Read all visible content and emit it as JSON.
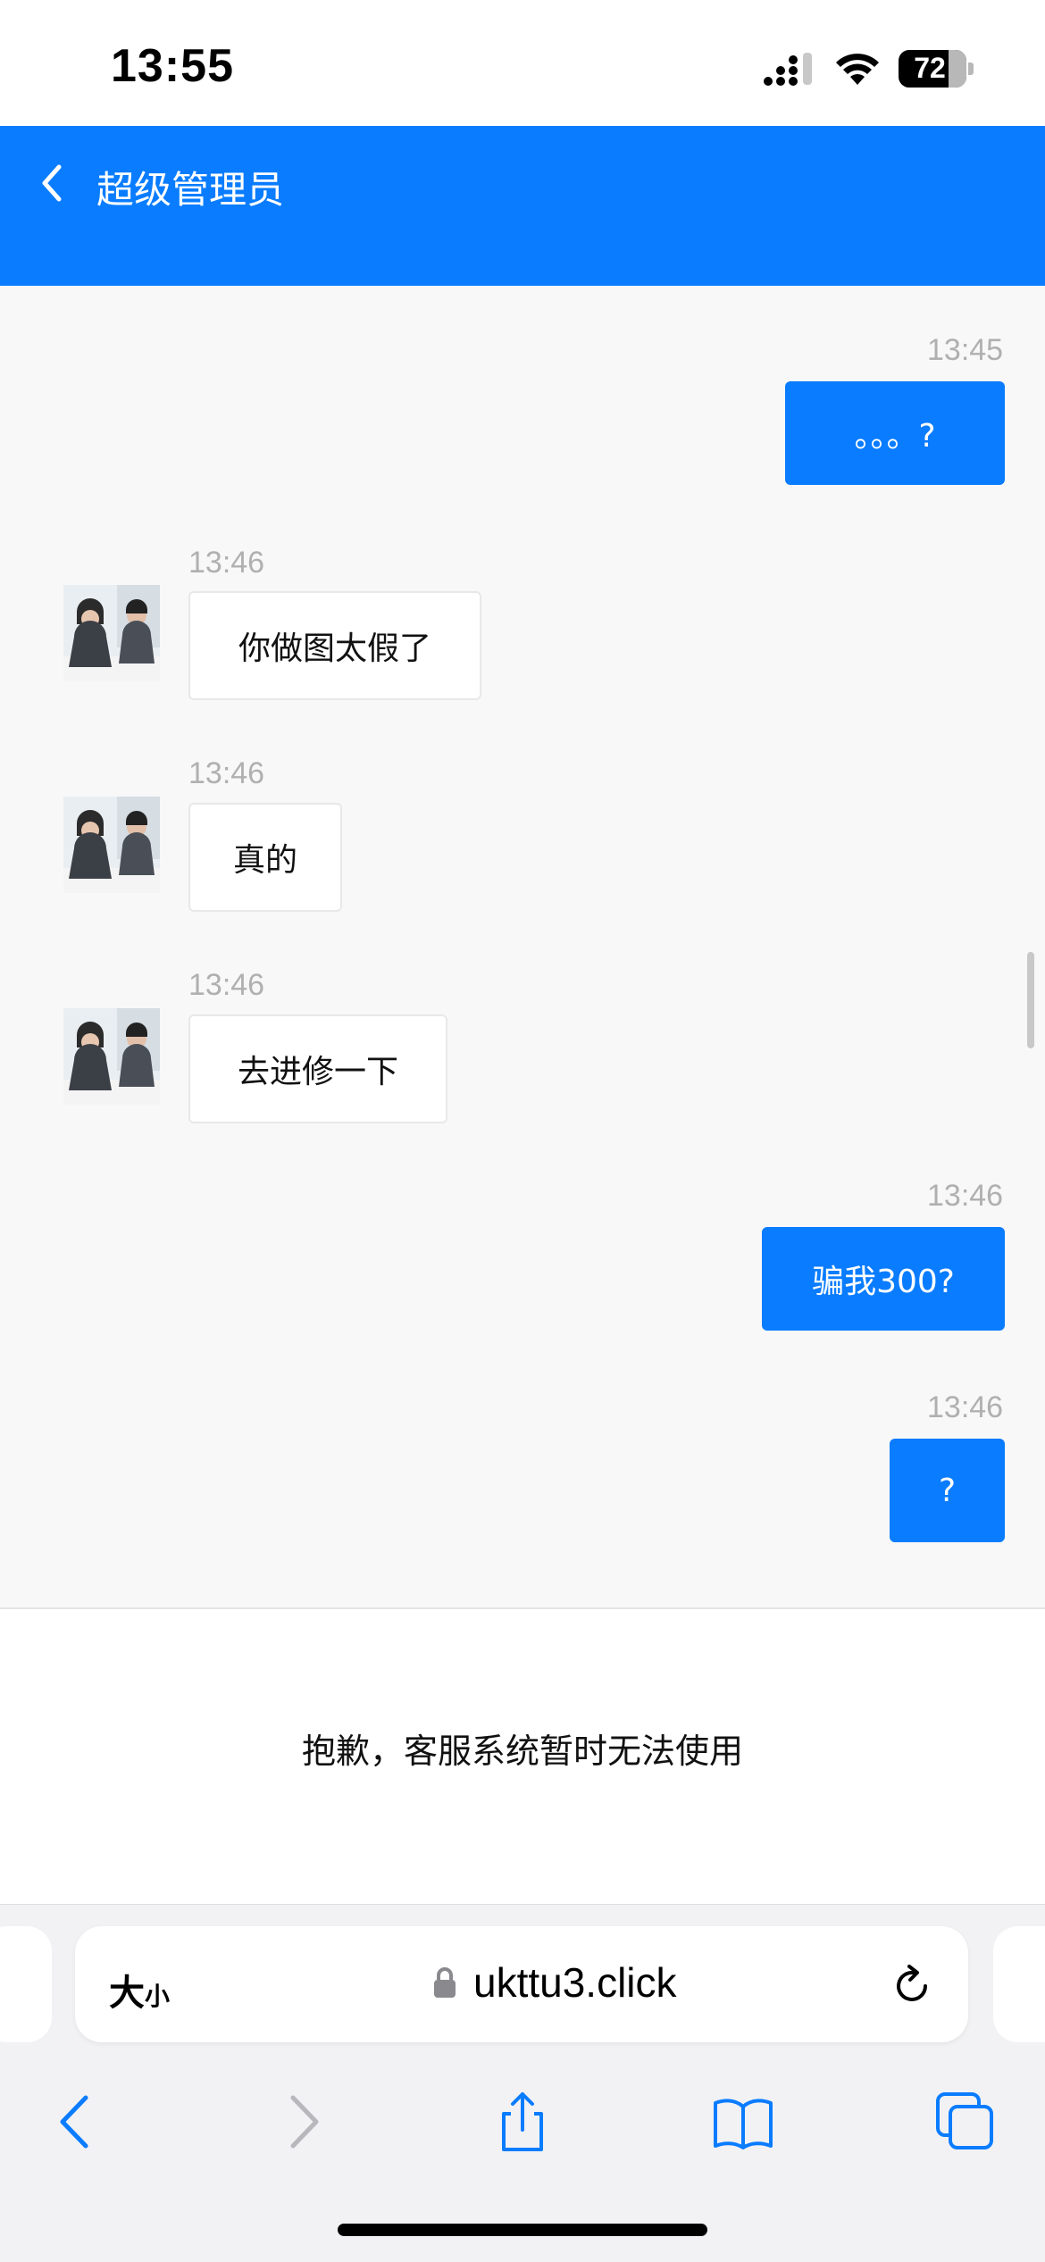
{
  "status_bar": {
    "time": "13:55",
    "battery": "72"
  },
  "header": {
    "title": "超级管理员"
  },
  "messages": [
    {
      "side": "out",
      "time": "13:45",
      "text": "。。。?"
    },
    {
      "side": "in",
      "time": "13:46",
      "text": "你做图太假了"
    },
    {
      "side": "in",
      "time": "13:46",
      "text": "真的"
    },
    {
      "side": "in",
      "time": "13:46",
      "text": "去进修一下"
    },
    {
      "side": "out",
      "time": "13:46",
      "text": "骗我300?"
    },
    {
      "side": "out",
      "time": "13:46",
      "text": "?"
    }
  ],
  "system_notice": "抱歉，客服系统暂时无法使用",
  "browser": {
    "text_size_label_big": "大",
    "text_size_label_small": "小",
    "url": "ukttu3.click"
  },
  "colors": {
    "accent": "#0a7cff",
    "chat_bg": "#f8f8f8",
    "timestamp": "#b0b0b0"
  },
  "icons": [
    "signal-icon",
    "wifi-icon",
    "battery-icon",
    "back-chevron-icon",
    "agent-avatar",
    "lock-icon",
    "reload-icon",
    "safari-back-icon",
    "safari-forward-icon",
    "share-icon",
    "bookmarks-icon",
    "tabs-icon"
  ]
}
